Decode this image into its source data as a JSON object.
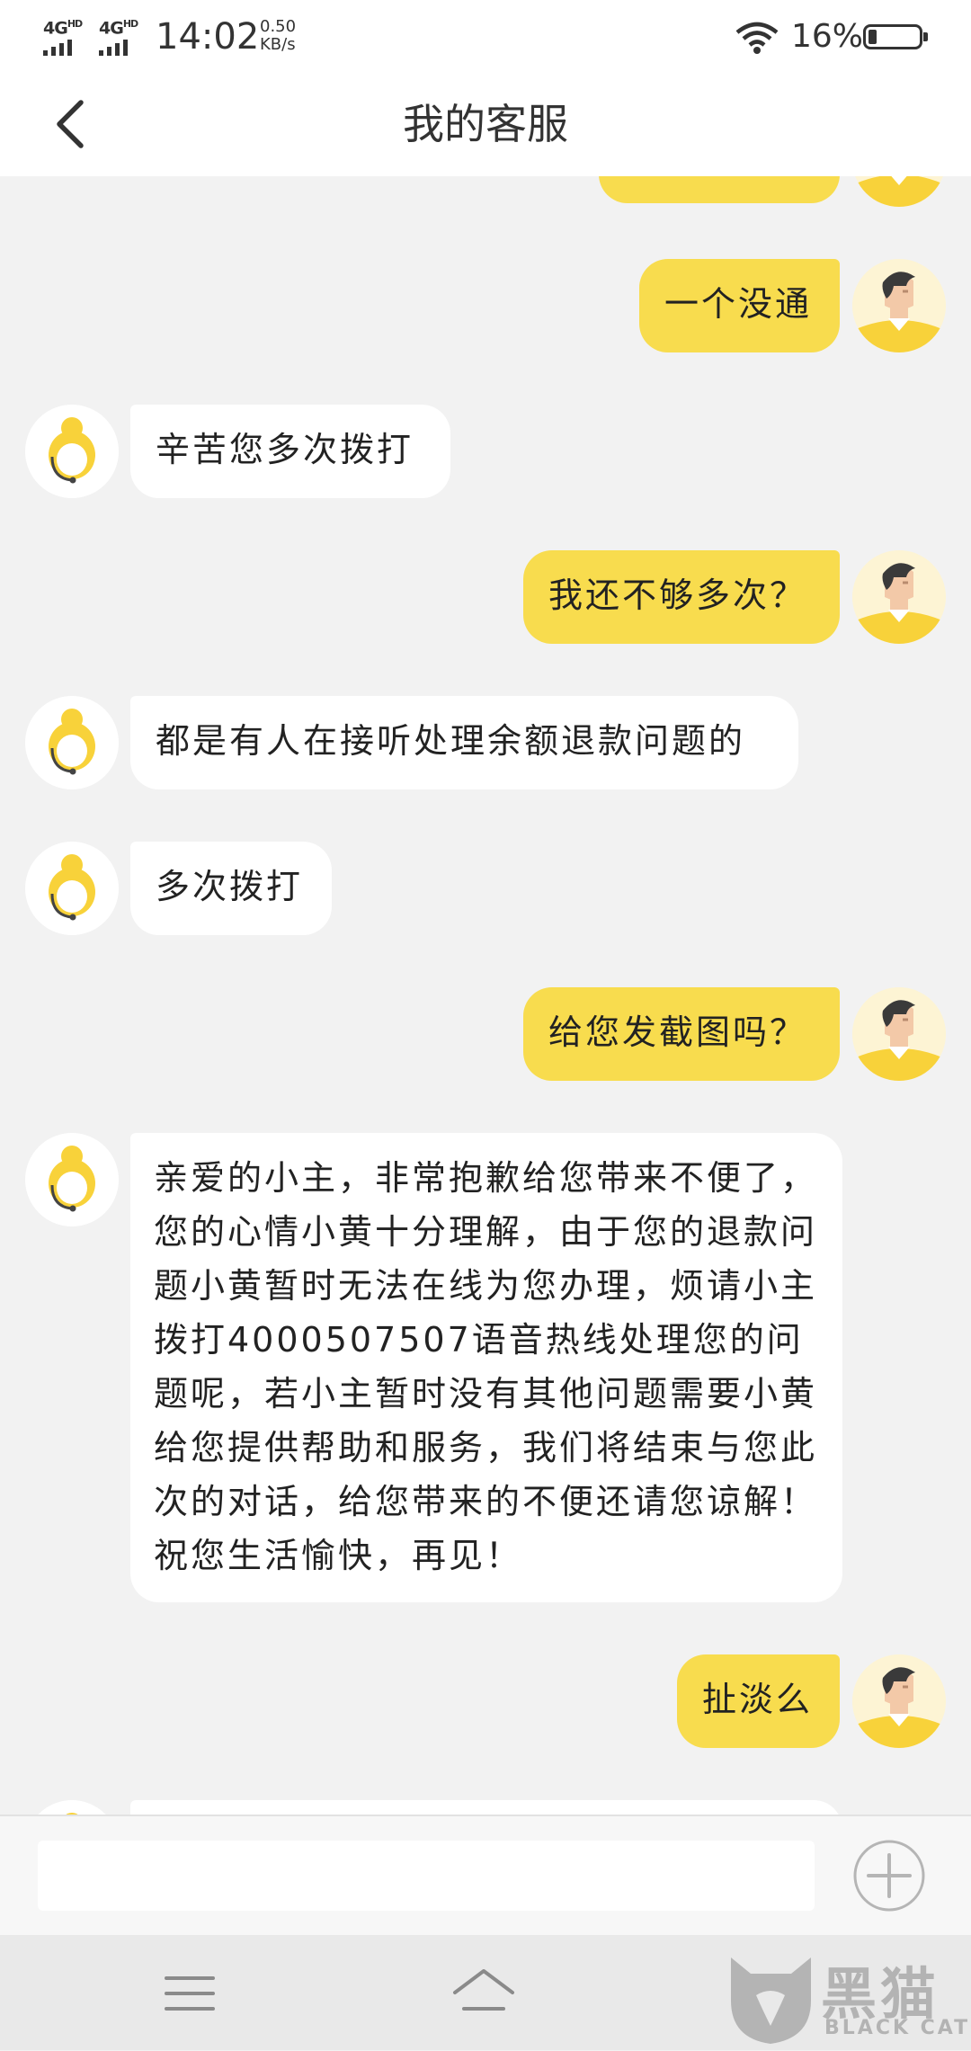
{
  "status_bar": {
    "network_1": "4G",
    "network_1_sup": "HD",
    "network_2": "4G",
    "network_2_sup": "HD",
    "time": "14:02",
    "speed_value": "0.50",
    "speed_unit": "KB/s",
    "battery_percent": "16%",
    "battery_level": 0.16,
    "icons": [
      "signal-icon",
      "wifi-icon",
      "battery-icon"
    ]
  },
  "nav": {
    "title": "我的客服",
    "back_icon": "chevron-left-icon"
  },
  "messages": [
    {
      "sender": "user",
      "text": "",
      "avatar": "user-avatar"
    },
    {
      "sender": "user",
      "text": "一个没通",
      "avatar": "user-avatar"
    },
    {
      "sender": "agent",
      "text": "辛苦您多次拨打",
      "avatar": "agent-avatar"
    },
    {
      "sender": "user",
      "text": "我还不够多次？",
      "avatar": "user-avatar"
    },
    {
      "sender": "agent",
      "text": "都是有人在接听处理余额退款问题的",
      "avatar": "agent-avatar"
    },
    {
      "sender": "agent",
      "text": "多次拨打",
      "avatar": "agent-avatar"
    },
    {
      "sender": "user",
      "text": "给您发截图吗？",
      "avatar": "user-avatar"
    },
    {
      "sender": "agent",
      "text": "亲爱的小主，非常抱歉给您带来不便了，您的心情小黄十分理解，由于您的退款问题小黄暂时无法在线为您办理，烦请小主拨打4000507507语音热线处理您的问题呢，若小主暂时没有其他问题需要小黄给您提供帮助和服务，我们将结束与您此次的对话，给您带来的不便还请您谅解！祝您生活愉快，再见！",
      "avatar": "agent-avatar"
    },
    {
      "sender": "user",
      "text": "扯淡么",
      "avatar": "user-avatar"
    },
    {
      "sender": "agent",
      "text": "",
      "avatar": "agent-avatar"
    }
  ],
  "input_bar": {
    "placeholder": "",
    "value": "",
    "plus_icon": "plus-circle-icon"
  },
  "system_nav": {
    "icons": [
      "menu-icon",
      "home-icon"
    ]
  },
  "watermark": {
    "text_cn": "黑猫",
    "text_en": "BLACK CAT"
  },
  "colors": {
    "user_bubble": "#f8dc4e",
    "agent_bubble": "#ffffff",
    "chat_background": "#f2f2f2",
    "avatar_yellow": "#f8d23a"
  }
}
